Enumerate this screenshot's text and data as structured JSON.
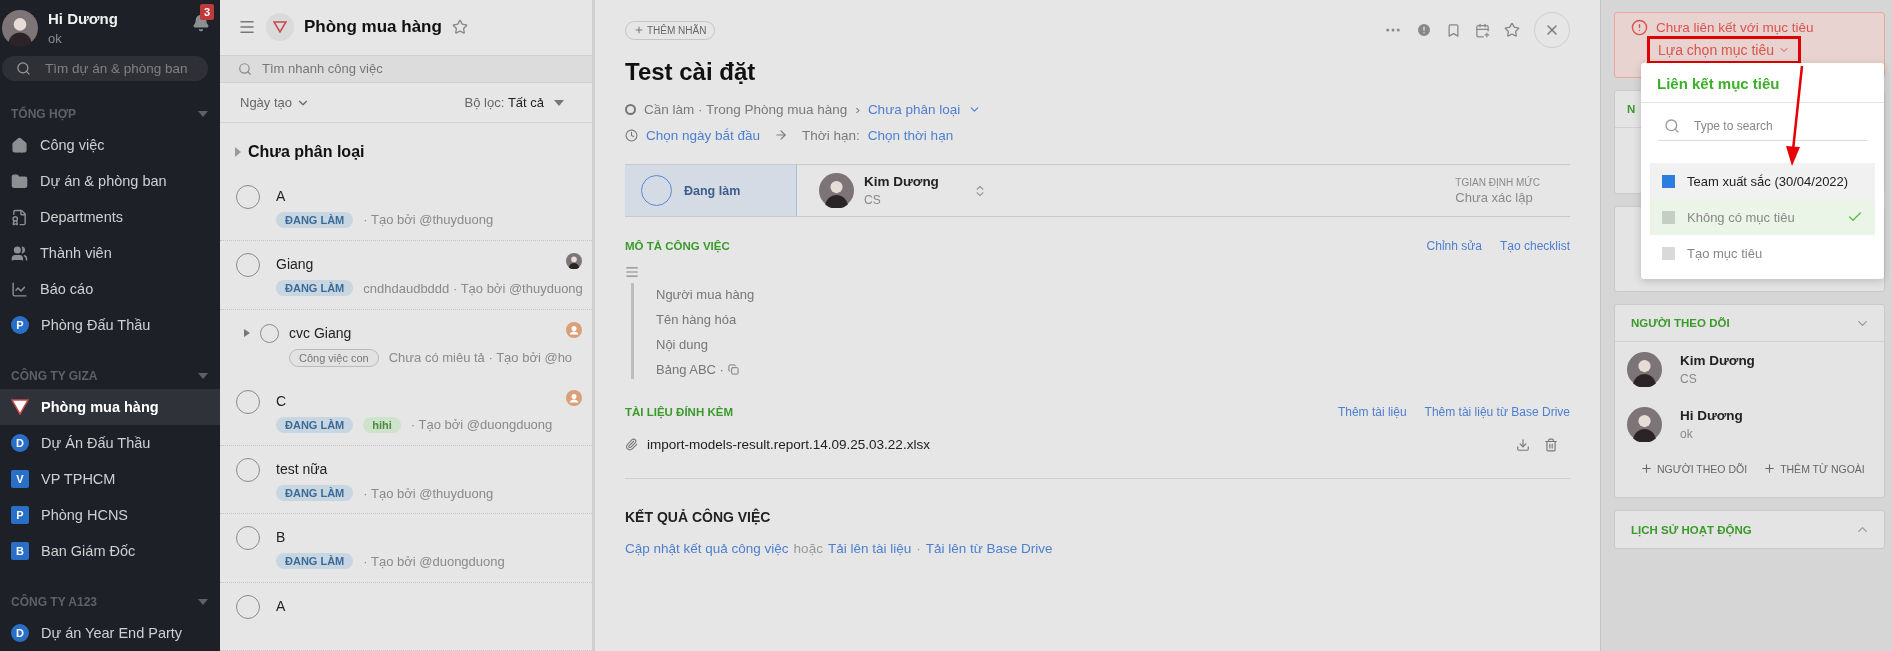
{
  "sidebar": {
    "user": {
      "name": "Hi Dương",
      "status": "ok"
    },
    "notifications": "3",
    "search": {
      "placeholder": "Tìm dự án & phòng ban"
    },
    "groups": [
      {
        "title": "TỔNG HỢP",
        "items": [
          {
            "label": "Công việc",
            "kind": "home",
            "selected": false
          },
          {
            "label": "Dự án & phòng ban",
            "kind": "folder",
            "selected": false
          },
          {
            "label": "Departments",
            "kind": "department",
            "selected": false
          },
          {
            "label": "Thành viên",
            "kind": "members",
            "selected": false
          },
          {
            "label": "Báo cáo",
            "kind": "report",
            "selected": false
          },
          {
            "label": "Phòng Đấu Thầu",
            "kind": "round",
            "badge": "P",
            "selected": false
          }
        ]
      },
      {
        "title": "CÔNG TY GIZA",
        "items": [
          {
            "label": "Phòng mua hàng",
            "kind": "triangle",
            "selected": true
          },
          {
            "label": "Dự Án Đấu Thầu",
            "kind": "round",
            "badge": "D",
            "selected": false
          },
          {
            "label": "VP TPHCM",
            "kind": "square",
            "badge": "V",
            "selected": false
          },
          {
            "label": "Phòng HCNS",
            "kind": "square",
            "badge": "P",
            "selected": false
          },
          {
            "label": "Ban Giám Đốc",
            "kind": "square",
            "badge": "B",
            "selected": false
          }
        ]
      },
      {
        "title": "CÔNG TY A123",
        "items": [
          {
            "label": "Dự án Year End Party",
            "kind": "round",
            "badge": "D",
            "selected": false
          }
        ]
      }
    ]
  },
  "tasks_pane": {
    "title": "Phòng mua hàng",
    "search": {
      "placeholder": "Tìm nhanh công việc"
    },
    "sort": "Ngày tạo",
    "filter_label": "Bộ lọc:",
    "filter_value": "Tất cả",
    "group": {
      "title": "Chưa phân loại",
      "expanded": false
    },
    "tasks": [
      {
        "title": "A",
        "kind": "task",
        "done": false,
        "tags": [
          {
            "kind": "status",
            "text": "ĐANG LÀM"
          }
        ],
        "meta": "· Tạo bởi @thuyduong"
      },
      {
        "title": "Giang",
        "kind": "task",
        "done": false,
        "assignee": {
          "kind": "photo"
        },
        "tags": [
          {
            "kind": "status",
            "text": "ĐANG LÀM"
          }
        ],
        "meta": "cndhdaudbddd · Tạo bởi @thuyduong"
      },
      {
        "title": "cvc Giang",
        "kind": "subtask",
        "done": false,
        "assignee": {
          "kind": "placeholder"
        },
        "tags": [
          {
            "kind": "outline",
            "text": "Công việc con"
          }
        ],
        "meta": "Chưa có miêu tả · Tạo bởi @ho"
      },
      {
        "title": "C",
        "kind": "task",
        "done": false,
        "assignee": {
          "kind": "placeholder"
        },
        "tags": [
          {
            "kind": "status",
            "text": "ĐANG LÀM"
          },
          {
            "kind": "label",
            "text": "hihi"
          }
        ],
        "meta": "· Tạo bởi @duongduong"
      },
      {
        "title": "test nữa",
        "kind": "task",
        "done": false,
        "tags": [
          {
            "kind": "status",
            "text": "ĐANG LÀM"
          }
        ],
        "meta": "· Tạo bởi @thuyduong"
      },
      {
        "title": "B",
        "kind": "task",
        "done": false,
        "tags": [
          {
            "kind": "status",
            "text": "ĐANG LÀM"
          }
        ],
        "meta": "· Tạo bởi @duongduong"
      },
      {
        "title": "A",
        "kind": "task",
        "done": false
      }
    ]
  },
  "task": {
    "add_label": "THÊM NHÃN",
    "title": "Test cài đặt",
    "status_text": "Cần làm · Trong Phòng mua hàng",
    "separator": "›",
    "category": "Chưa phân loại",
    "start_date": "Chọn ngày bắt đầu",
    "deadline_label": "Thời hạn:",
    "deadline": "Chọn thời hạn",
    "state": "Đang làm",
    "assignee": {
      "name": "Kim Dương",
      "role": "CS"
    },
    "norm": {
      "label": "TGIAN ĐỊNH MỨC",
      "value": "Chưa xác lập"
    },
    "description": {
      "title": "MÔ TẢ CÔNG VIỆC",
      "actions": [
        "Chỉnh sửa",
        "Tạo checklist"
      ],
      "lines": [
        "Người mua hàng",
        "Tên hàng hóa",
        "Nội dung",
        "Bảng ABC ·"
      ]
    },
    "attachments": {
      "title": "TÀI LIỆU ĐÍNH KÈM",
      "actions": [
        "Thêm tài liệu",
        "Thêm tài liệu từ Base Drive"
      ],
      "files": [
        "import-models-result.report.14.09.25.03.22.xlsx"
      ]
    },
    "result": {
      "title": "KẾT QUẢ CÔNG VIỆC",
      "parts": [
        {
          "kind": "link",
          "text": "Cập nhật kết quả công việc"
        },
        {
          "kind": "text",
          "text": "hoặc"
        },
        {
          "kind": "link",
          "text": "Tải lên tài liệu"
        },
        {
          "kind": "text",
          "text": "·"
        },
        {
          "kind": "link",
          "text": "Tải lên từ Base Drive"
        }
      ]
    }
  },
  "side": {
    "goal_alert": {
      "message": "Chưa liên kết với mục tiêu",
      "action": "Lựa chọn mục tiêu"
    },
    "goal_menu": {
      "title": "Liên kết mục tiêu",
      "search": {
        "placeholder": "Type to search"
      },
      "options": [
        {
          "label": "Team xuất sắc (30/04/2022)",
          "color": "#2b7de0",
          "selected": false,
          "hovered": true
        },
        {
          "label": "Không có mục tiêu",
          "color": "#c2cfc2",
          "selected": true,
          "hovered": false
        },
        {
          "label": "Tạo mục tiêu",
          "color": "#d9d9d9",
          "selected": false,
          "hovered": false
        }
      ]
    },
    "hidden_card_title": "N",
    "followers": {
      "title": "NGƯỜI THEO DÕI",
      "expanded": true,
      "people": [
        {
          "name": "Kim Dương",
          "role": "CS"
        },
        {
          "name": "Hi Dương",
          "role": "ok"
        }
      ],
      "actions": [
        "NGƯỜI THEO DÕI",
        "THÊM TỪ NGOÀI"
      ]
    },
    "history": {
      "title": "LỊCH SỬ HOẠT ĐỘNG",
      "expanded": false
    }
  }
}
